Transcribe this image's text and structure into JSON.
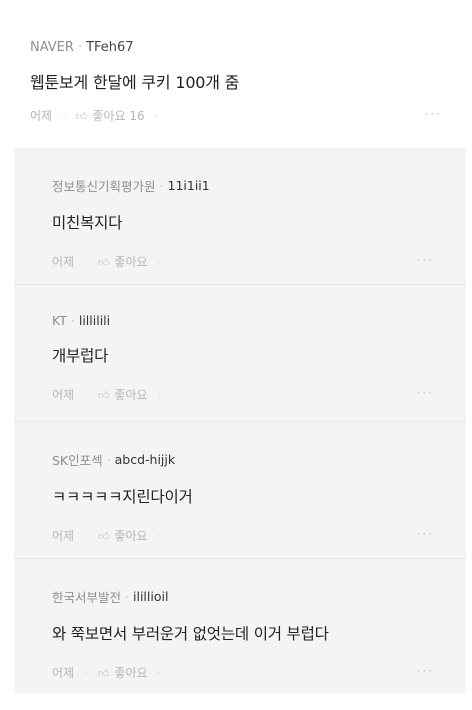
{
  "main_comment": {
    "source": "NAVER",
    "nickname": "TFeh67",
    "body": "웹툰보게 한달에 쿠키 100개 줌",
    "time": "어제",
    "like_label": "좋아요 16",
    "more_label": "···"
  },
  "replies": [
    {
      "source": "정보통신기획평가원",
      "nickname": "11i1ii1",
      "body": "미친복지다",
      "time": "어제",
      "like_label": "좋아요",
      "more_label": "···"
    },
    {
      "source": "KT",
      "nickname": "lillilili",
      "body": "개부럽다",
      "time": "어제",
      "like_label": "좋아요",
      "more_label": "···"
    },
    {
      "source": "SK인포섹",
      "nickname": "abcd-hijjk",
      "body": "ㅋㅋㅋㅋㅋ지린다이거",
      "time": "어제",
      "like_label": "좋아요",
      "more_label": "···"
    },
    {
      "source": "한국서부발전",
      "nickname": "ilillioil",
      "body": "와 쭉보면서 부러운거 없엇는데 이거 부럽다",
      "time": "어제",
      "like_label": "좋아요",
      "more_label": "···"
    }
  ],
  "icons": {
    "like": "thumbs-up-icon",
    "more": "more-dots-icon"
  }
}
